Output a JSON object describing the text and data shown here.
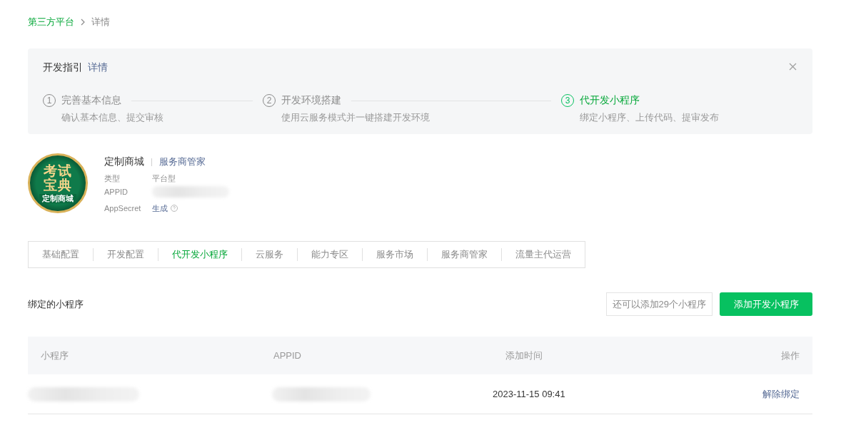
{
  "breadcrumb": [
    {
      "label": "第三方平台",
      "link": true
    },
    {
      "label": "详情",
      "link": false
    }
  ],
  "guide": {
    "title": "开发指引",
    "link": "详情",
    "steps": [
      {
        "number": "1",
        "title": "完善基本信息",
        "desc": "确认基本信息、提交审核",
        "selected": false
      },
      {
        "number": "2",
        "title": "开发环境搭建",
        "desc": "使用云服务模式并一键搭建开发环境",
        "selected": false
      },
      {
        "number": "3",
        "title": "代开发小程序",
        "desc": "绑定小程序、上传代码、提审发布",
        "selected": true
      }
    ]
  },
  "account": {
    "logo": {
      "lines": [
        "考试",
        "宝典"
      ],
      "caption": "定制商城"
    },
    "name": "定制商城",
    "tag": "服务商管家",
    "fields": [
      {
        "label": "类型",
        "kind": "text",
        "value": "平台型"
      },
      {
        "label": "APPID",
        "kind": "redacted"
      },
      {
        "label": "AppSecret",
        "kind": "action",
        "value": "生成"
      }
    ]
  },
  "tabs": [
    {
      "label": "基础配置",
      "selected": false
    },
    {
      "label": "开发配置",
      "selected": false
    },
    {
      "label": "代开发小程序",
      "selected": true
    },
    {
      "label": "云服务",
      "selected": false
    },
    {
      "label": "能力专区",
      "selected": false
    },
    {
      "label": "服务市场",
      "selected": false
    },
    {
      "label": "服务商管家",
      "selected": false
    },
    {
      "label": "流量主代运营",
      "selected": false
    }
  ],
  "section": {
    "title": "绑定的小程序",
    "hint": "还可以添加29个小程序",
    "button": "添加开发小程序"
  },
  "table": {
    "columns": [
      "小程序",
      "APPID",
      "添加时间",
      "操作"
    ],
    "rows": [
      {
        "added": "2023-11-15 09:41",
        "action": "解除绑定"
      }
    ]
  }
}
